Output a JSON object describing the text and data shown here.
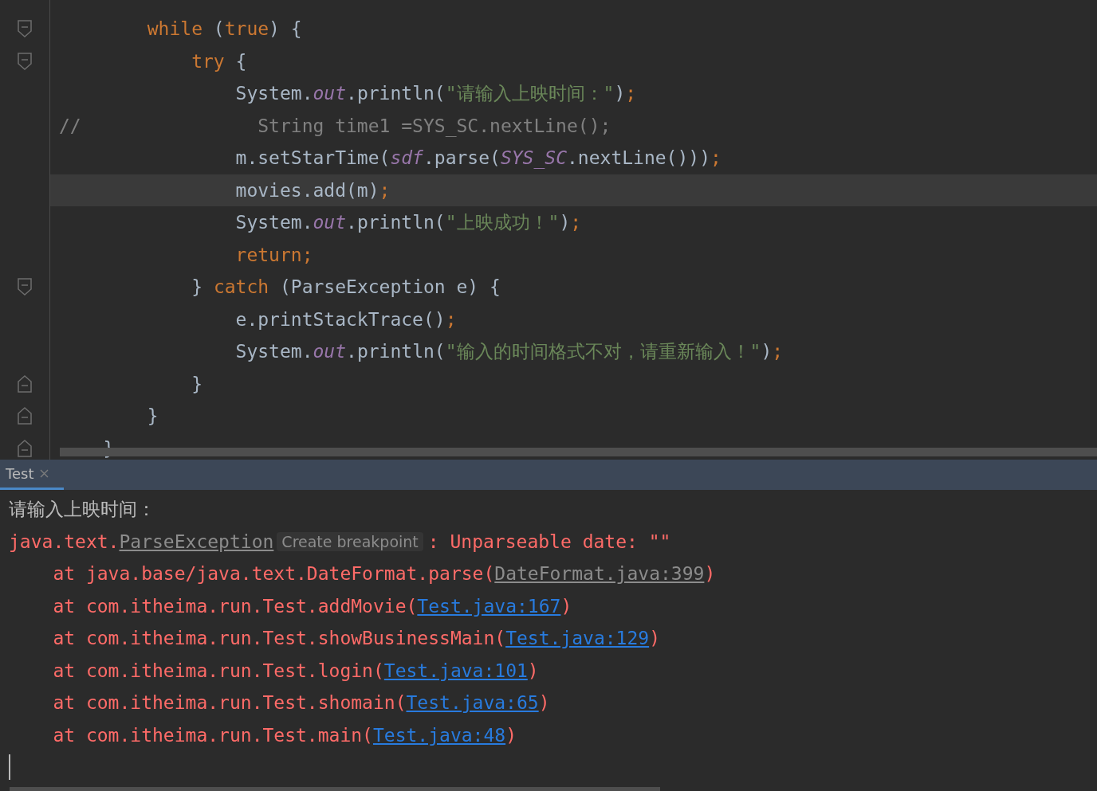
{
  "editor": {
    "lines": [
      {
        "current": false,
        "kind": "fold_start",
        "tokens": [
          {
            "kind": "keyword",
            "text": "        while"
          },
          {
            "kind": "plain",
            "text": " ("
          },
          {
            "kind": "keyword",
            "text": "true"
          },
          {
            "kind": "plain",
            "text": ") {"
          }
        ]
      },
      {
        "current": false,
        "kind": "fold_start",
        "tokens": [
          {
            "kind": "keyword",
            "text": "            try"
          },
          {
            "kind": "plain",
            "text": " {"
          }
        ]
      },
      {
        "current": false,
        "kind": "code",
        "tokens": [
          {
            "kind": "plain",
            "text": "                System."
          },
          {
            "kind": "static",
            "text": "out"
          },
          {
            "kind": "plain",
            "text": ".println("
          },
          {
            "kind": "string",
            "text": "\"请输入上映时间：\""
          },
          {
            "kind": "plain",
            "text": ")"
          },
          {
            "kind": "keyword",
            "text": ";"
          }
        ]
      },
      {
        "current": false,
        "kind": "code",
        "tokens": [
          {
            "kind": "comment",
            "text": "//                String time1 =SYS_SC.nextLine();"
          }
        ]
      },
      {
        "current": false,
        "kind": "code",
        "tokens": [
          {
            "kind": "plain",
            "text": "                m.setStarTime("
          },
          {
            "kind": "static",
            "text": "sdf"
          },
          {
            "kind": "plain",
            "text": ".parse("
          },
          {
            "kind": "static",
            "text": "SYS_SC"
          },
          {
            "kind": "plain",
            "text": ".nextLine()))"
          },
          {
            "kind": "keyword",
            "text": ";"
          }
        ]
      },
      {
        "current": true,
        "kind": "code",
        "tokens": [
          {
            "kind": "plain",
            "text": "                movies.add(m)"
          },
          {
            "kind": "keyword",
            "text": ";"
          }
        ]
      },
      {
        "current": false,
        "kind": "code",
        "tokens": [
          {
            "kind": "plain",
            "text": "                System."
          },
          {
            "kind": "static",
            "text": "out"
          },
          {
            "kind": "plain",
            "text": ".println("
          },
          {
            "kind": "string",
            "text": "\"上映成功！\""
          },
          {
            "kind": "plain",
            "text": ")"
          },
          {
            "kind": "keyword",
            "text": ";"
          }
        ]
      },
      {
        "current": false,
        "kind": "code",
        "tokens": [
          {
            "kind": "keyword",
            "text": "                return;"
          }
        ]
      },
      {
        "current": false,
        "kind": "fold_start",
        "tokens": [
          {
            "kind": "plain",
            "text": "            } "
          },
          {
            "kind": "keyword",
            "text": "catch"
          },
          {
            "kind": "plain",
            "text": " (ParseException e) {"
          }
        ]
      },
      {
        "current": false,
        "kind": "code",
        "tokens": [
          {
            "kind": "plain",
            "text": "                e.printStackTrace()"
          },
          {
            "kind": "keyword",
            "text": ";"
          }
        ]
      },
      {
        "current": false,
        "kind": "code",
        "tokens": [
          {
            "kind": "plain",
            "text": "                System."
          },
          {
            "kind": "static",
            "text": "out"
          },
          {
            "kind": "plain",
            "text": ".println("
          },
          {
            "kind": "string",
            "text": "\"输入的时间格式不对，请重新输入！\""
          },
          {
            "kind": "plain",
            "text": ")"
          },
          {
            "kind": "keyword",
            "text": ";"
          }
        ]
      },
      {
        "current": false,
        "kind": "fold_end",
        "tokens": [
          {
            "kind": "plain",
            "text": "            }"
          }
        ]
      },
      {
        "current": false,
        "kind": "fold_end",
        "tokens": [
          {
            "kind": "plain",
            "text": "        }"
          }
        ]
      },
      {
        "current": false,
        "kind": "fold_end",
        "tokens": [
          {
            "kind": "plain",
            "text": "    }"
          }
        ]
      }
    ]
  },
  "run_panel": {
    "tabs": [
      {
        "label": "Test",
        "selected": true
      }
    ],
    "lines": [
      {
        "kind": "output",
        "segments": [
          {
            "kind": "plain",
            "text": "请输入上映时间："
          }
        ]
      },
      {
        "kind": "error",
        "segments": [
          {
            "kind": "plain",
            "text": "java.text."
          },
          {
            "kind": "library_link",
            "text": "ParseException"
          },
          {
            "kind": "hint",
            "text": "Create breakpoint"
          },
          {
            "kind": "plain",
            "text": ": Unparseable date: \"\""
          }
        ]
      },
      {
        "kind": "error",
        "segments": [
          {
            "kind": "plain",
            "text": "    at java.base/java.text.DateFormat.parse("
          },
          {
            "kind": "library_link",
            "text": "DateFormat.java:399"
          },
          {
            "kind": "plain",
            "text": ")"
          }
        ]
      },
      {
        "kind": "error",
        "segments": [
          {
            "kind": "plain",
            "text": "    at com.itheima.run.Test.addMovie("
          },
          {
            "kind": "link",
            "text": "Test.java:167"
          },
          {
            "kind": "plain",
            "text": ")"
          }
        ]
      },
      {
        "kind": "error",
        "segments": [
          {
            "kind": "plain",
            "text": "    at com.itheima.run.Test.showBusinessMain("
          },
          {
            "kind": "link",
            "text": "Test.java:129"
          },
          {
            "kind": "plain",
            "text": ")"
          }
        ]
      },
      {
        "kind": "error",
        "segments": [
          {
            "kind": "plain",
            "text": "    at com.itheima.run.Test.login("
          },
          {
            "kind": "link",
            "text": "Test.java:101"
          },
          {
            "kind": "plain",
            "text": ")"
          }
        ]
      },
      {
        "kind": "error",
        "segments": [
          {
            "kind": "plain",
            "text": "    at com.itheima.run.Test.shomain("
          },
          {
            "kind": "link",
            "text": "Test.java:65"
          },
          {
            "kind": "plain",
            "text": ")"
          }
        ]
      },
      {
        "kind": "error",
        "segments": [
          {
            "kind": "plain",
            "text": "    at com.itheima.run.Test.main("
          },
          {
            "kind": "link",
            "text": "Test.java:48"
          },
          {
            "kind": "plain",
            "text": ")"
          }
        ]
      }
    ]
  }
}
